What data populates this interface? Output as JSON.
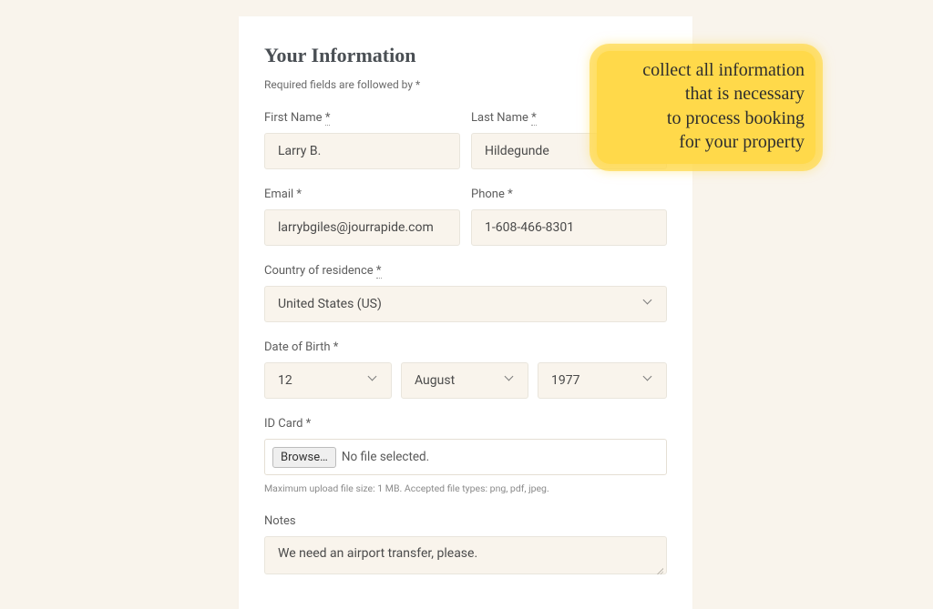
{
  "heading": "Your Information",
  "subtitle": "Required fields are followed by *",
  "labels": {
    "first_name": "First Name",
    "last_name": "Last Name",
    "email": "Email *",
    "phone": "Phone *",
    "country": "Country of residence",
    "dob": "Date of Birth *",
    "idcard": "ID Card *",
    "notes": "Notes"
  },
  "values": {
    "first_name": "Larry B.",
    "last_name": "Hildegunde",
    "email": "larrybgiles@jourrapide.com",
    "phone": "1-608-466-8301",
    "country": "United States (US)",
    "dob_day": "12",
    "dob_month": "August",
    "dob_year": "1977",
    "file_status": "No file selected.",
    "notes": "We need an airport transfer, please."
  },
  "browse_label": "Browse…",
  "upload_hint": "Maximum upload file size: 1 MB. Accepted file types: png, pdf, jpeg.",
  "callout": "collect all information\nthat is necessary\nto process booking\nfor your property",
  "req_mark": "*"
}
